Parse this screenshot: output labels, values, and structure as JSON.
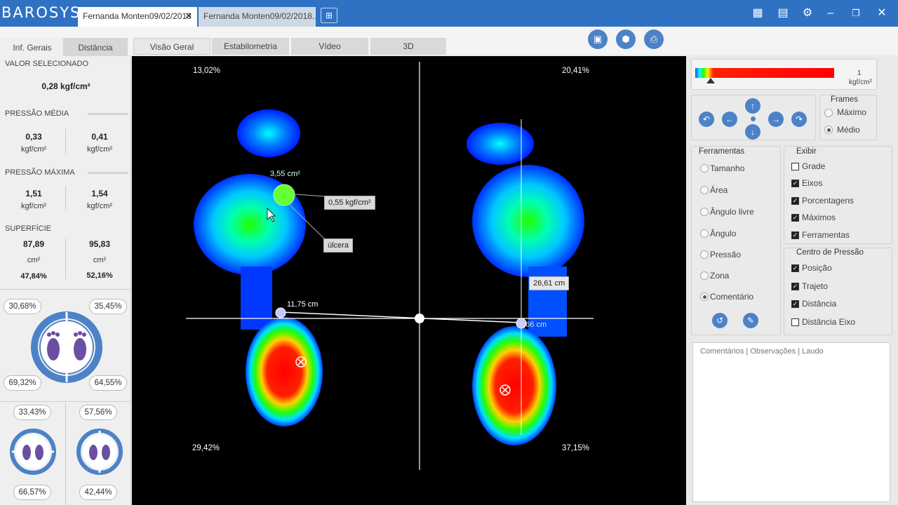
{
  "app": {
    "logo": "BAROSYS"
  },
  "file_tabs": [
    {
      "label": "Fernanda Monten09/02/2018"
    },
    {
      "label": "Fernanda Monten09/02/2018..."
    }
  ],
  "left_tabs": [
    "Inf. Gerais",
    "Distância"
  ],
  "center_tabs": [
    "Visão Geral",
    "Estabilometria",
    "Vídeo",
    "3D"
  ],
  "left": {
    "selected_title": "VALOR SELECIONADO",
    "selected_value": "0,28 kgf/cm²",
    "mean_title": "PRESSÃO MÉDIA",
    "mean_left": "0,33",
    "mean_right": "0,41",
    "unit": "kgf/cm²",
    "max_title": "PRESSÃO MÁXIMA",
    "max_left": "1,51",
    "max_right": "1,54",
    "surface_title": "SUPERFÍCIE",
    "surf_left": "87,89",
    "surf_right": "95,83",
    "surf_unit": "cm²",
    "surf_left_pct": "47,84%",
    "surf_right_pct": "52,16%",
    "big_tl": "30,68%",
    "big_tr": "35,45%",
    "big_bl": "69,32%",
    "big_br": "64,55%",
    "small_l_top": "33,43%",
    "small_l_bottom": "66,57%",
    "small_r_top": "57,56%",
    "small_r_bottom": "42,44%"
  },
  "view": {
    "q_tl": "13,02%",
    "q_tr": "20,41%",
    "q_bl": "29,42%",
    "q_br": "37,15%",
    "area_label": "3,55 cm²",
    "pressure_label": "0,55 kgf/cm²",
    "comment_label": "úlcera",
    "dist_horizontal": "11,75 cm",
    "dist_vertical": "26,61 cm",
    "dist_small": "8,66 cm"
  },
  "scale": {
    "value": "1",
    "unit": "kgf/cm²"
  },
  "frames": {
    "title": "Frames",
    "options": [
      "Máximo",
      "Médio"
    ],
    "selected": "Médio"
  },
  "tools": {
    "title": "Ferramentas",
    "options": [
      "Tamanho",
      "Área",
      "Ângulo livre",
      "Ângulo",
      "Pressão",
      "Zona",
      "Comentário"
    ],
    "selected": "Comentário"
  },
  "show": {
    "title": "Exibir",
    "items": [
      {
        "label": "Grade",
        "checked": false
      },
      {
        "label": "Eixos",
        "checked": true
      },
      {
        "label": "Porcentagens",
        "checked": true
      },
      {
        "label": "Máximos",
        "checked": true
      },
      {
        "label": "Ferramentas",
        "checked": true
      }
    ]
  },
  "cop": {
    "title": "Centro de Pressão",
    "items": [
      {
        "label": "Posição",
        "checked": true
      },
      {
        "label": "Trajeto",
        "checked": true
      },
      {
        "label": "Distância",
        "checked": true
      },
      {
        "label": "Distância Eixo",
        "checked": false
      }
    ]
  },
  "comments": {
    "placeholder": "Comentários | Observações | Laudo"
  },
  "colors": {
    "titlebar": "#2f72c4",
    "accent": "#4c82c7"
  }
}
